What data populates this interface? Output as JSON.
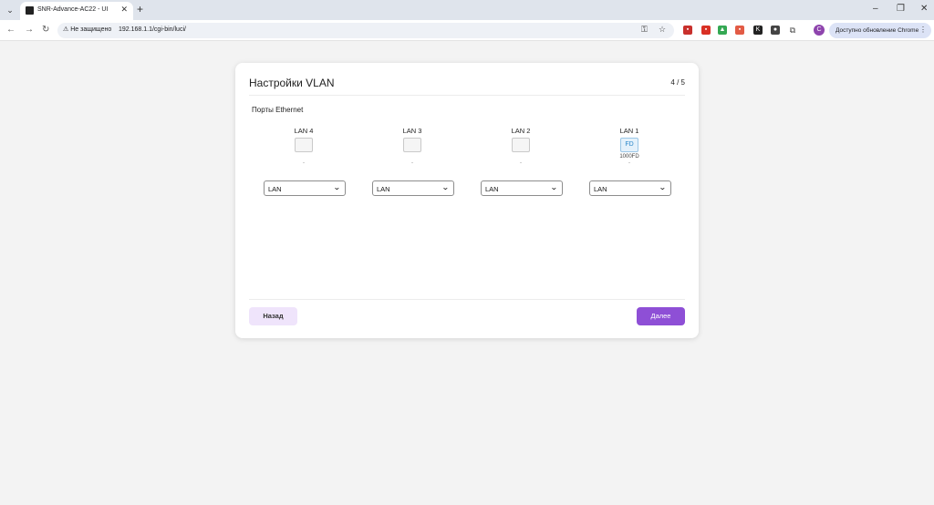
{
  "browser": {
    "tab_title": "SNR-Advance-AC22 - UI",
    "tab_close": "✕",
    "new_tab": "+",
    "insecure_label": "Не защищено",
    "url": "192.168.1.1/cgi-bin/luci/",
    "profile_initial": "C",
    "update_label": "Доступно обновление Chrome",
    "extensions": [
      {
        "name": "pdf",
        "color": "#c8302c"
      },
      {
        "name": "acrobat",
        "color": "#d93025"
      },
      {
        "name": "drive",
        "color": "#34a853"
      },
      {
        "name": "extension-red",
        "color": "#e25b45"
      },
      {
        "name": "k-extension",
        "color": "#222222"
      },
      {
        "name": "vpn",
        "color": "#444444"
      }
    ]
  },
  "wizard": {
    "title": "Настройки VLAN",
    "step": "4 / 5",
    "section_title": "Порты Ethernet",
    "ports": [
      {
        "label": "LAN 4",
        "status": "",
        "speed": "",
        "dash": "-",
        "mode": "LAN"
      },
      {
        "label": "LAN 3",
        "status": "",
        "speed": "",
        "dash": "-",
        "mode": "LAN"
      },
      {
        "label": "LAN 2",
        "status": "",
        "speed": "",
        "dash": "-",
        "mode": "LAN"
      },
      {
        "label": "LAN 1",
        "status": "FD",
        "speed": "1000FD",
        "dash": "-",
        "mode": "LAN"
      }
    ],
    "back_label": "Назад",
    "next_label": "Далее"
  }
}
